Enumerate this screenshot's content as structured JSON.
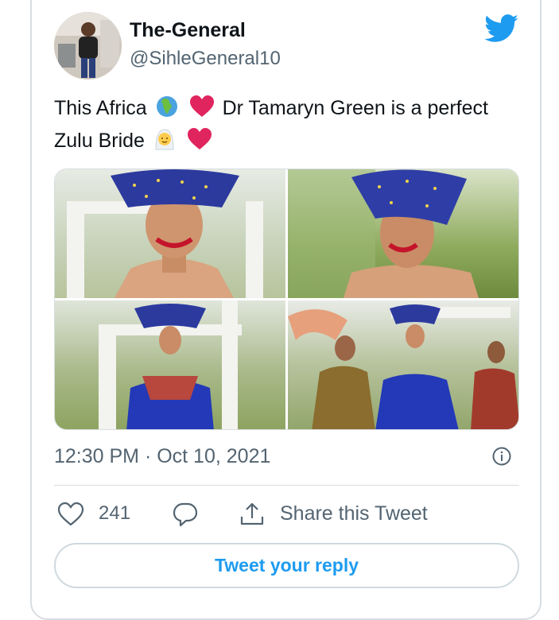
{
  "tweet": {
    "display_name": "The-General",
    "handle": "@SihleGeneral10",
    "text_part1": "This Africa",
    "text_part2": "Dr Tamaryn Green is a perfect",
    "text_part3": "Zulu Bride",
    "timestamp": "12:30 PM · Oct 10, 2021",
    "likes": "241",
    "share_label": "Share this Tweet",
    "reply_label": "Tweet your reply"
  },
  "icons": {
    "brand": "twitter-bird-icon",
    "info": "info-icon",
    "like": "heart-icon",
    "reply": "reply-icon",
    "share": "share-icon",
    "emoji_globe": "globe-africa-emoji",
    "emoji_heart": "red-heart-emoji",
    "emoji_bride": "bride-with-veil-emoji"
  },
  "colors": {
    "accent": "#1d9bf0",
    "secondary_text": "#536471",
    "heart": "#e0245e"
  }
}
